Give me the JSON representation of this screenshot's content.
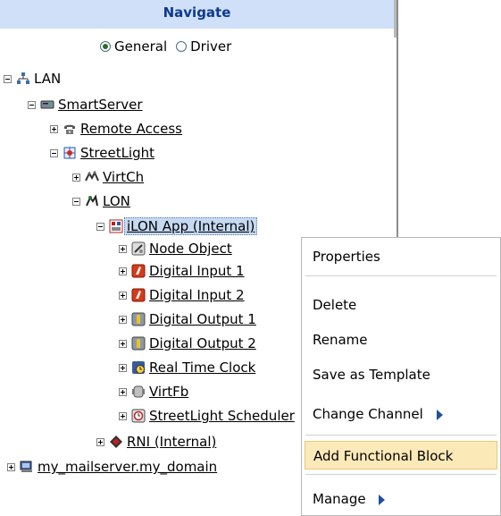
{
  "header": {
    "title": "Navigate"
  },
  "view_mode": {
    "options": [
      {
        "label": "General",
        "selected": true
      },
      {
        "label": "Driver",
        "selected": false
      }
    ]
  },
  "tree": {
    "lan": "LAN",
    "smartserver": "SmartServer",
    "remote_access": "Remote Access",
    "streetlight": "StreetLight",
    "virtch": "VirtCh",
    "lon": "LON",
    "ilon_app": "iLON App (Internal)",
    "node_object": "Node Object",
    "digital_input_1": "Digital Input 1",
    "digital_input_2": "Digital Input 2",
    "digital_output_1": "Digital Output 1",
    "digital_output_2": "Digital Output 2",
    "real_time_clock": "Real Time Clock",
    "virtfb": "VirtFb",
    "streetlight_sch": "StreetLight Scheduler",
    "rni": "RNI (Internal)",
    "mailserver": "my_mailserver.my_domain"
  },
  "context_menu": {
    "properties": "Properties",
    "delete": "Delete",
    "rename": "Rename",
    "save_as_template": "Save as Template",
    "change_channel": "Change Channel",
    "add_functional_block": "Add Functional Block",
    "manage": "Manage",
    "highlighted_item": "Add Functional Block"
  }
}
